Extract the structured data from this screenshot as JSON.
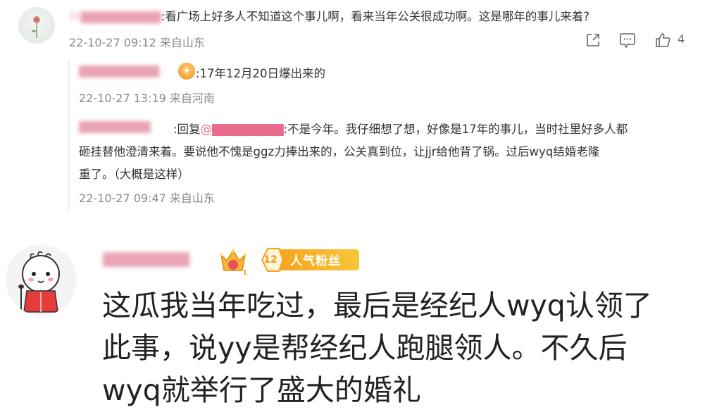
{
  "top_comment": {
    "author": "Ｈ▇▇▇▇▇▇▇▇▇",
    "text": ":看广场上好多人不知道这个事儿啊，看来当年公关很成功啊。这是哪年的事儿来着?",
    "meta": "22-10-27 09:12 来自山东",
    "like_count": "4",
    "icons": [
      "share-icon",
      "comment-icon",
      "thumbs-up-icon"
    ]
  },
  "replies": [
    {
      "author": "▇▇▇▇▇▇▇▇▇",
      "text": ":17年12月20日爆出来的",
      "meta": "22-10-27 13:19 来自河南"
    },
    {
      "author": "▇▇▇▇▇▇▇▇",
      "reply_prefix": ":回复",
      "mention": "@▇▇▇▇▇▇▇▇",
      "line1": ":不是今年。我仔细想了想，好像是17年的事儿，当时社里好多人都",
      "line2": "砸挂替他澄清来着。要说他不愧是ggz力捧出来的，公关真到位，让jjr给他背了锅。过后wyq结婚老隆",
      "line3": "重了。（大概是这样）",
      "meta": "22-10-27 09:47 来自山东"
    }
  ],
  "main_comment": {
    "author": "▇▇▇▇▇▇▇▇",
    "crown_level": "1",
    "fan_level": "12",
    "fan_label": "人气粉丝",
    "line1": "这瓜我当年吃过，最后是经纪人wyq认领了",
    "line2": "此事，说yy是帮经纪人跑腿领人。不久后",
    "line3": "wyq就举行了盛大的婚礼"
  }
}
